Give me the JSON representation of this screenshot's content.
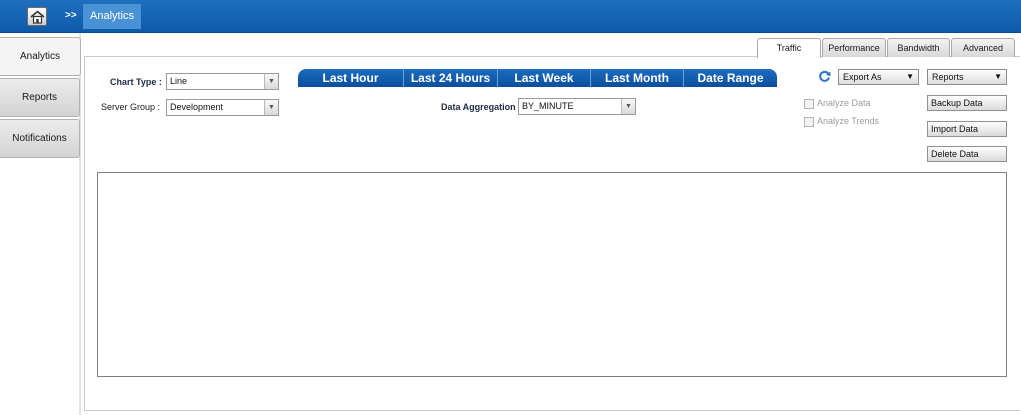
{
  "topbar": {
    "home_icon": "home-icon",
    "separator": ">>",
    "breadcrumb_active": "Analytics"
  },
  "sidebar": {
    "items": [
      {
        "label": "Analytics",
        "active": true
      },
      {
        "label": "Reports",
        "active": false
      },
      {
        "label": "Notifications",
        "active": false
      }
    ]
  },
  "tabs": [
    {
      "label": "Traffic",
      "active": true
    },
    {
      "label": "Performance",
      "active": false
    },
    {
      "label": "Bandwidth",
      "active": false
    },
    {
      "label": "Advanced",
      "active": false
    }
  ],
  "filters": {
    "chart_type_label": "Chart Type :",
    "chart_type_value": "Line",
    "server_group_label": "Server Group :",
    "server_group_value": "Development",
    "aggregation_label": "Data Aggregation :",
    "aggregation_value": "BY_MINUTE"
  },
  "ranges": [
    "Last Hour",
    "Last 24 Hours",
    "Last Week",
    "Last Month",
    "Date Range"
  ],
  "actions": {
    "refresh_icon": "refresh-icon",
    "export_label": "Export As",
    "reports_label": "Reports",
    "analyze_data": "Analyze Data",
    "analyze_trends": "Analyze Trends",
    "backup": "Backup Data",
    "import": "Import Data",
    "delete": "Delete Data"
  },
  "colors": {
    "topbar": "#0d5aa8",
    "breadcrumb_active": "#4a92d6",
    "range_bar": "#0b4f9c"
  }
}
